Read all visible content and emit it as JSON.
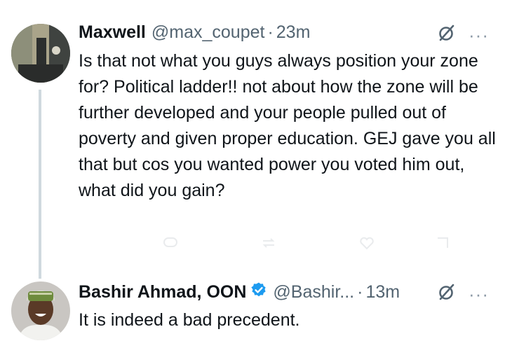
{
  "tweets": [
    {
      "name": "Maxwell",
      "handle": "@max_coupet",
      "separator": "·",
      "time": "23m",
      "text": "Is that not what you guys always position your zone for? Political ladder!! not about how the zone will be further developed and your people pulled out of poverty and given proper education. GEJ gave you all that but cos you wanted power you voted him out, what did you gain?",
      "more": "···",
      "verified": false
    },
    {
      "name": "Bashir Ahmad, OON",
      "handle": "@Bashir...",
      "separator": "·",
      "time": "13m",
      "text": "It is indeed a bad precedent.",
      "more": "···",
      "verified": true
    }
  ],
  "colors": {
    "text": "#0f1419",
    "secondary": "#536471",
    "thread_line": "#cfd9de",
    "verified_badge": "#1d9bf0"
  },
  "icons": [
    "grok-icon",
    "more-icon",
    "verified-badge-icon",
    "avatar"
  ]
}
